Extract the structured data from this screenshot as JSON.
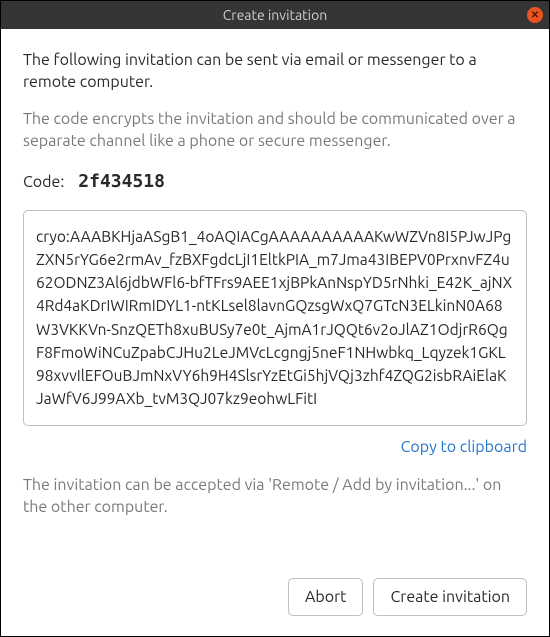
{
  "titlebar": {
    "title": "Create invitation"
  },
  "intro": "The following invitation can be sent via email or messenger to a remote computer.",
  "encrypt_note": "The code encrypts the invitation and should be communicated over a separate channel like a phone or secure messenger.",
  "code": {
    "label": "Code:",
    "value": "2f434518"
  },
  "invitation_text": "cryo:AAABKHjaASgB1_4oAQIACgAAAAAAAAAAKwWZVn8I5PJwJPgZXN5rYG6e2rmAv_fzBXFgdcLjI1EltkPIA_m7Jma43IBEPV0PrxnvFZ4u62ODNZ3Al6jdbWFl6-bfTFrs9AEE1xjBPkAnNspYD5rNhki_E42K_ajNX4Rd4aKDrIWIRmIDYL1-ntKLsel8lavnGQzsgWxQ7GTcN3ELkinN0A68W3VKKVn-SnzQETh8xuBUSy7e0t_AjmA1rJQQt6v2oJlAZ1OdjrR6QgF8FmoWiNCuZpabCJHu2LeJMVcLcgngj5neF1NHwbkq_Lqyzek1GKL98xvvIlEFOuBJmNxVY6h9H4SlsrYzEtGi5hjVQj3zhf4ZQG2isbRAiElaKJaWfV6J99AXb_tvM3QJ07kz9eohwLFitI",
  "copy_link": "Copy to clipboard",
  "accept_note": "The invitation can be accepted via 'Remote / Add by invitation...' on the other computer.",
  "buttons": {
    "abort": "Abort",
    "create": "Create invitation"
  }
}
